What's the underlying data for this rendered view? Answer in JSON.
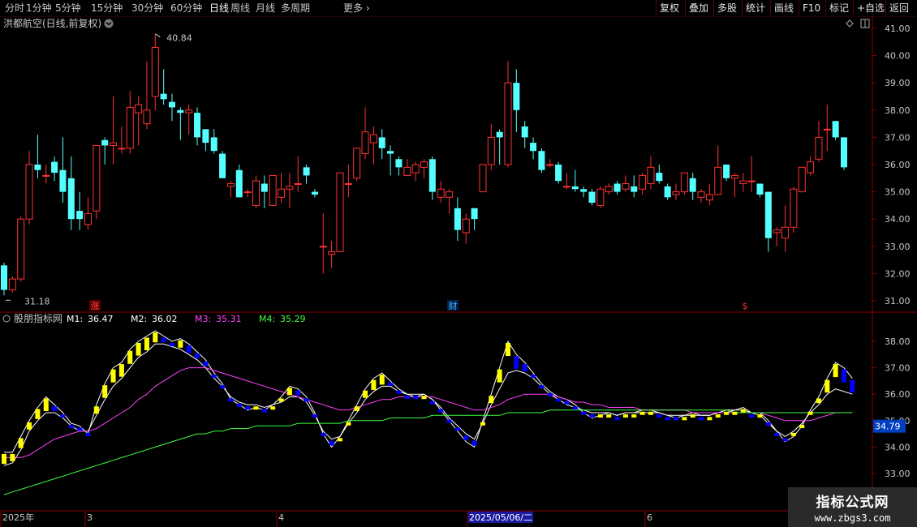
{
  "toolbar": {
    "periods": [
      "分时",
      "1分钟",
      "5分钟",
      "15分钟",
      "30分钟",
      "60分钟",
      "日线",
      "周线",
      "月线",
      "多周期"
    ],
    "active_period": "日线",
    "more_label": "更多",
    "more_icon": "chevron-right-icon",
    "right_buttons": [
      "复权",
      "叠加",
      "多股",
      "统计",
      "画线",
      "F10",
      "标记",
      "+自选",
      "返回"
    ]
  },
  "main_panel": {
    "title": "洪都航空(日线,前复权)",
    "title_icon": "chevron-down-icon",
    "header_icons": [
      "diamond-icon",
      "panel-icon"
    ],
    "price_ticks": [
      "41.00",
      "40.00",
      "39.00",
      "38.00",
      "37.00",
      "36.00",
      "35.00",
      "34.00",
      "33.00",
      "32.00",
      "31.00"
    ],
    "max_label": "40.84",
    "min_label": "31.18",
    "markers": [
      {
        "text": "涨",
        "color": "#ff4040",
        "bg": "#5a0000"
      },
      {
        "text": "财",
        "color": "#40b0ff",
        "bg": "#00204a"
      },
      {
        "text": "$",
        "color": "#ff3030",
        "bg": "#000000"
      }
    ]
  },
  "indicator": {
    "name": "股朋指标网",
    "icon": "circle-icon",
    "lines": [
      {
        "label": "M1:",
        "value": "36.47",
        "color": "#ffffff"
      },
      {
        "label": "M2:",
        "value": "36.02",
        "color": "#ffffff"
      },
      {
        "label": "M3:",
        "value": "35.31",
        "color": "#ff40ff"
      },
      {
        "label": "M4:",
        "value": "35.29",
        "color": "#40ff40"
      }
    ],
    "ticks": [
      "38.00",
      "37.00",
      "36.00",
      "35.00",
      "34.00",
      "33.00"
    ],
    "current_value": "34.79"
  },
  "date_axis": {
    "labels": [
      "2025年",
      "3",
      "4",
      "2025/05/06/二",
      "6"
    ],
    "cursor_date": "2025/05/06/二"
  },
  "watermark": {
    "line1": "指标公式网",
    "line2": "www.zbgs3.com"
  },
  "colors": {
    "up": "#ff3232",
    "down": "#54ffff",
    "grid": "#8b0000",
    "axis_text": "#c8c8c8",
    "yellow": "#ffff00",
    "blue": "#0000ff"
  },
  "chart_data": {
    "type": "candlestick",
    "title": "洪都航空(日线,前复权)",
    "ylim": [
      31.0,
      41.0
    ],
    "candles": [
      [
        32.3,
        31.4,
        32.4,
        31.2
      ],
      [
        31.4,
        31.8,
        31.9,
        31.3
      ],
      [
        31.8,
        34.0,
        34.1,
        31.7
      ],
      [
        34.0,
        36.0,
        36.5,
        33.8
      ],
      [
        36.0,
        35.8,
        37.1,
        35.5
      ],
      [
        35.6,
        35.6,
        36.0,
        35.3
      ],
      [
        36.1,
        35.7,
        36.3,
        35.4
      ],
      [
        35.8,
        35.0,
        37.0,
        34.6
      ],
      [
        35.5,
        34.0,
        36.3,
        33.6
      ],
      [
        34.3,
        34.0,
        35.0,
        33.6
      ],
      [
        33.8,
        34.2,
        34.8,
        33.6
      ],
      [
        34.3,
        36.7,
        36.7,
        34.0
      ],
      [
        36.9,
        36.7,
        37.0,
        36.0
      ],
      [
        36.7,
        36.8,
        38.5,
        36.0
      ],
      [
        36.6,
        36.6,
        37.4,
        36.4
      ],
      [
        36.6,
        38.1,
        38.7,
        36.4
      ],
      [
        37.9,
        38.2,
        38.5,
        36.7
      ],
      [
        37.5,
        38.0,
        39.8,
        37.3
      ],
      [
        38.5,
        40.3,
        40.8,
        38.0
      ],
      [
        38.6,
        38.4,
        39.5,
        38.2
      ],
      [
        38.3,
        38.1,
        38.6,
        37.6
      ],
      [
        38.0,
        37.9,
        38.1,
        36.9
      ],
      [
        37.9,
        38.0,
        38.2,
        37.1
      ],
      [
        37.9,
        37.0,
        38.1,
        36.7
      ],
      [
        37.3,
        36.8,
        37.3,
        36.5
      ],
      [
        37.0,
        36.5,
        37.3,
        36.4
      ],
      [
        36.4,
        35.5,
        36.5,
        35.5
      ],
      [
        35.2,
        35.3,
        35.4,
        34.8
      ],
      [
        35.8,
        34.8,
        36.0,
        34.8
      ],
      [
        35.0,
        35.0,
        35.1,
        34.8
      ],
      [
        34.5,
        35.4,
        35.6,
        34.4
      ],
      [
        35.3,
        35.0,
        35.6,
        34.4
      ],
      [
        34.5,
        35.6,
        35.6,
        34.5
      ],
      [
        34.8,
        35.1,
        35.7,
        34.6
      ],
      [
        35.1,
        35.2,
        35.7,
        34.4
      ],
      [
        35.3,
        35.3,
        36.3,
        35.0
      ],
      [
        35.9,
        35.6,
        36.0,
        35.3
      ],
      [
        35.0,
        34.9,
        35.1,
        34.8
      ],
      [
        33.0,
        33.0,
        34.2,
        32.0
      ],
      [
        32.7,
        32.8,
        33.2,
        32.2
      ],
      [
        32.8,
        35.7,
        35.7,
        32.8
      ],
      [
        35.3,
        35.3,
        36.0,
        34.8
      ],
      [
        35.5,
        36.6,
        36.6,
        35.4
      ],
      [
        36.4,
        37.2,
        38.1,
        36.2
      ],
      [
        36.8,
        37.1,
        37.4,
        36.0
      ],
      [
        37.0,
        36.6,
        37.3,
        36.2
      ],
      [
        36.5,
        36.4,
        36.7,
        35.6
      ],
      [
        36.2,
        35.9,
        36.3,
        35.6
      ],
      [
        35.6,
        35.9,
        36.2,
        35.6
      ],
      [
        35.7,
        36.0,
        36.1,
        35.4
      ],
      [
        35.9,
        36.1,
        36.2,
        35.5
      ],
      [
        36.2,
        35.0,
        36.3,
        34.7
      ],
      [
        34.8,
        35.1,
        35.4,
        34.6
      ],
      [
        34.8,
        35.0,
        35.1,
        34.2
      ],
      [
        34.4,
        33.6,
        34.8,
        33.2
      ],
      [
        33.5,
        34.0,
        34.2,
        33.1
      ],
      [
        34.4,
        34.0,
        34.2,
        33.6
      ],
      [
        35.0,
        36.0,
        36.0,
        35.0
      ],
      [
        36.0,
        37.0,
        37.5,
        35.8
      ],
      [
        37.2,
        37.0,
        37.3,
        36.0
      ],
      [
        36.0,
        39.0,
        39.8,
        35.9
      ],
      [
        39.0,
        38.0,
        39.5,
        37.2
      ],
      [
        37.4,
        37.0,
        37.6,
        36.6
      ],
      [
        36.8,
        36.5,
        37.0,
        36.2
      ],
      [
        36.5,
        35.8,
        36.6,
        35.7
      ],
      [
        36.0,
        36.0,
        36.2,
        35.9
      ],
      [
        36.0,
        35.4,
        36.1,
        35.3
      ],
      [
        35.2,
        35.2,
        35.7,
        35.1
      ],
      [
        35.2,
        35.1,
        35.8,
        35.0
      ],
      [
        35.1,
        35.0,
        35.2,
        34.8
      ],
      [
        35.0,
        34.6,
        35.1,
        34.5
      ],
      [
        34.5,
        35.1,
        35.2,
        34.4
      ],
      [
        35.0,
        35.2,
        35.3,
        34.9
      ],
      [
        35.3,
        35.0,
        35.4,
        34.9
      ],
      [
        35.1,
        35.3,
        35.6,
        35.0
      ],
      [
        35.2,
        35.0,
        35.6,
        34.8
      ],
      [
        35.1,
        35.6,
        35.7,
        34.9
      ],
      [
        35.3,
        35.9,
        36.3,
        35.1
      ],
      [
        35.7,
        35.4,
        36.0,
        35.3
      ],
      [
        35.2,
        34.8,
        35.3,
        34.7
      ],
      [
        34.9,
        35.0,
        35.3,
        34.7
      ],
      [
        35.0,
        35.7,
        35.7,
        34.9
      ],
      [
        35.5,
        35.0,
        35.7,
        34.7
      ],
      [
        34.8,
        35.0,
        35.1,
        34.6
      ],
      [
        34.7,
        34.9,
        35.3,
        34.5
      ],
      [
        34.9,
        35.9,
        36.7,
        34.9
      ],
      [
        36.0,
        35.5,
        36.0,
        35.4
      ],
      [
        35.5,
        35.6,
        35.7,
        34.8
      ],
      [
        35.3,
        35.4,
        35.7,
        35.0
      ],
      [
        35.4,
        35.4,
        36.3,
        35.0
      ],
      [
        35.3,
        34.9,
        35.3,
        34.8
      ],
      [
        35.0,
        33.3,
        35.0,
        32.8
      ],
      [
        33.5,
        33.6,
        33.7,
        33.0
      ],
      [
        33.3,
        33.7,
        34.5,
        32.8
      ],
      [
        33.7,
        35.1,
        35.2,
        33.5
      ],
      [
        35.0,
        35.9,
        35.9,
        35.0
      ],
      [
        35.7,
        36.1,
        36.3,
        35.6
      ],
      [
        36.2,
        37.0,
        37.6,
        36.1
      ],
      [
        37.3,
        37.3,
        38.2,
        36.5
      ],
      [
        37.6,
        37.0,
        37.6,
        36.9
      ],
      [
        37.0,
        35.9,
        37.0,
        35.8
      ]
    ],
    "indicator_series": [
      {
        "name": "M1",
        "values": [
          33.8,
          33.8,
          34.4,
          35.0,
          35.5,
          35.9,
          35.6,
          35.3,
          34.9,
          34.8,
          34.5,
          35.6,
          36.4,
          37.0,
          37.2,
          37.7,
          38.0,
          38.2,
          38.4,
          38.2,
          38.0,
          38.1,
          37.9,
          37.6,
          37.3,
          36.8,
          36.4,
          35.8,
          35.6,
          35.4,
          35.5,
          35.4,
          35.6,
          35.9,
          36.3,
          36.2,
          35.9,
          35.3,
          34.5,
          34.0,
          34.4,
          35.0,
          35.6,
          36.2,
          36.6,
          36.8,
          36.5,
          36.2,
          36.0,
          35.9,
          36.0,
          35.8,
          35.4,
          35.0,
          34.6,
          34.2,
          34.0,
          35.0,
          36.0,
          37.0,
          38.0,
          37.5,
          37.2,
          36.8,
          36.4,
          36.1,
          35.9,
          35.8,
          35.6,
          35.3,
          35.1,
          35.2,
          35.3,
          35.2,
          35.3,
          35.3,
          35.4,
          35.4,
          35.3,
          35.2,
          35.1,
          35.2,
          35.3,
          35.2,
          35.2,
          35.3,
          35.4,
          35.4,
          35.5,
          35.3,
          35.3,
          35.0,
          34.6,
          34.2,
          34.4,
          34.8,
          35.4,
          35.9,
          36.6,
          37.2,
          37.0,
          36.6
        ]
      },
      {
        "name": "M2",
        "values": [
          33.3,
          33.4,
          33.9,
          34.6,
          35.0,
          35.3,
          35.3,
          35.1,
          34.8,
          34.6,
          34.6,
          35.2,
          35.8,
          36.3,
          36.6,
          37.0,
          37.4,
          37.6,
          37.9,
          37.9,
          37.8,
          37.7,
          37.5,
          37.3,
          37.0,
          36.6,
          36.3,
          35.9,
          35.7,
          35.6,
          35.6,
          35.5,
          35.6,
          35.7,
          35.9,
          35.9,
          35.7,
          35.2,
          34.6,
          34.3,
          34.4,
          34.9,
          35.3,
          35.8,
          36.1,
          36.3,
          36.3,
          36.1,
          36.0,
          36.0,
          36.0,
          35.8,
          35.5,
          35.1,
          34.8,
          34.5,
          34.3,
          34.9,
          35.6,
          36.2,
          36.8,
          36.9,
          36.8,
          36.6,
          36.3,
          36.0,
          35.8,
          35.6,
          35.5,
          35.4,
          35.3,
          35.3,
          35.3,
          35.2,
          35.3,
          35.3,
          35.3,
          35.3,
          35.3,
          35.2,
          35.2,
          35.2,
          35.2,
          35.2,
          35.2,
          35.3,
          35.3,
          35.4,
          35.4,
          35.3,
          35.2,
          34.9,
          34.6,
          34.4,
          34.6,
          34.9,
          35.3,
          35.6,
          36.0,
          36.2,
          36.1,
          36.0
        ]
      },
      {
        "name": "M3",
        "values": [
          33.6,
          33.6,
          33.6,
          33.7,
          33.9,
          34.1,
          34.3,
          34.4,
          34.5,
          34.6,
          34.6,
          34.7,
          34.9,
          35.1,
          35.3,
          35.5,
          35.8,
          36.0,
          36.3,
          36.5,
          36.7,
          36.9,
          37.0,
          37.0,
          37.0,
          36.9,
          36.8,
          36.7,
          36.6,
          36.5,
          36.4,
          36.3,
          36.2,
          36.1,
          36.0,
          35.9,
          35.8,
          35.7,
          35.6,
          35.5,
          35.4,
          35.4,
          35.5,
          35.6,
          35.7,
          35.8,
          35.8,
          35.9,
          35.9,
          35.9,
          35.9,
          35.9,
          35.8,
          35.7,
          35.6,
          35.5,
          35.4,
          35.4,
          35.5,
          35.6,
          35.8,
          35.9,
          36.0,
          36.0,
          36.0,
          36.0,
          35.9,
          35.8,
          35.7,
          35.7,
          35.6,
          35.6,
          35.5,
          35.5,
          35.5,
          35.5,
          35.4,
          35.4,
          35.4,
          35.4,
          35.4,
          35.4,
          35.3,
          35.3,
          35.3,
          35.3,
          35.3,
          35.3,
          35.3,
          35.3,
          35.3,
          35.2,
          35.1,
          35.0,
          35.0,
          35.0,
          35.0,
          35.1,
          35.2,
          35.3,
          35.3,
          35.3
        ]
      },
      {
        "name": "M4",
        "values": [
          32.2,
          32.3,
          32.4,
          32.5,
          32.6,
          32.7,
          32.8,
          32.9,
          33.0,
          33.1,
          33.2,
          33.3,
          33.4,
          33.5,
          33.6,
          33.7,
          33.8,
          33.9,
          34.0,
          34.1,
          34.2,
          34.3,
          34.4,
          34.5,
          34.5,
          34.6,
          34.6,
          34.7,
          34.7,
          34.7,
          34.8,
          34.8,
          34.8,
          34.8,
          34.8,
          34.9,
          34.9,
          34.9,
          34.9,
          34.9,
          34.9,
          35.0,
          35.0,
          35.0,
          35.0,
          35.0,
          35.1,
          35.1,
          35.1,
          35.1,
          35.1,
          35.2,
          35.2,
          35.2,
          35.2,
          35.2,
          35.2,
          35.2,
          35.2,
          35.2,
          35.3,
          35.3,
          35.3,
          35.3,
          35.3,
          35.4,
          35.4,
          35.4,
          35.4,
          35.4,
          35.4,
          35.4,
          35.4,
          35.4,
          35.4,
          35.4,
          35.4,
          35.4,
          35.4,
          35.4,
          35.4,
          35.4,
          35.4,
          35.4,
          35.4,
          35.4,
          35.4,
          35.3,
          35.3,
          35.3,
          35.3,
          35.3,
          35.3,
          35.3,
          35.3,
          35.3,
          35.3,
          35.3,
          35.3,
          35.3,
          35.3,
          35.3
        ]
      }
    ]
  }
}
